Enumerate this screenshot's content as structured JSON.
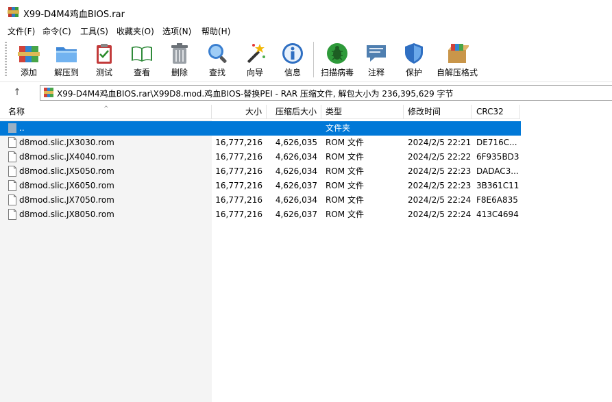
{
  "window": {
    "title": "X99-D4M4鸡血BIOS.rar",
    "app_icon": "winrar-icon"
  },
  "menu": [
    {
      "label": "文件(F)"
    },
    {
      "label": "命令(C)"
    },
    {
      "label": "工具(S)"
    },
    {
      "label": "收藏夹(O)"
    },
    {
      "label": "选项(N)"
    },
    {
      "label": "帮助(H)"
    }
  ],
  "toolbar": [
    {
      "label": "添加",
      "icon": "add-archive-icon"
    },
    {
      "label": "解压到",
      "icon": "extract-folder-icon"
    },
    {
      "label": "测试",
      "icon": "test-clipboard-icon"
    },
    {
      "label": "查看",
      "icon": "view-book-icon"
    },
    {
      "label": "删除",
      "icon": "trash-icon"
    },
    {
      "label": "查找",
      "icon": "find-magnifier-icon"
    },
    {
      "label": "向导",
      "icon": "wizard-wand-icon"
    },
    {
      "label": "信息",
      "icon": "info-icon"
    },
    {
      "label": "扫描病毒",
      "icon": "virus-scan-icon"
    },
    {
      "label": "注释",
      "icon": "comment-icon"
    },
    {
      "label": "保护",
      "icon": "shield-icon"
    },
    {
      "label": "自解压格式",
      "icon": "sfx-box-icon"
    }
  ],
  "address": {
    "up_icon": "up-arrow-icon",
    "path": "X99-D4M4鸡血BIOS.rar\\X99D8.mod.鸡血BIOS-替换PEI - RAR 压缩文件, 解包大小为 236,395,629 字节"
  },
  "columns": {
    "name": "名称",
    "size": "大小",
    "packed": "压缩后大小",
    "type": "类型",
    "modified": "修改时间",
    "crc": "CRC32"
  },
  "parent_row": {
    "name": "..",
    "type": "文件夹"
  },
  "files": [
    {
      "name": "d8mod.slic.JX3030.rom",
      "size": "16,777,216",
      "packed": "4,626,035",
      "type": "ROM 文件",
      "modified": "2024/2/5 22:21",
      "crc": "DE716C..."
    },
    {
      "name": "d8mod.slic.JX4040.rom",
      "size": "16,777,216",
      "packed": "4,626,034",
      "type": "ROM 文件",
      "modified": "2024/2/5 22:22",
      "crc": "6F935BD3"
    },
    {
      "name": "d8mod.slic.JX5050.rom",
      "size": "16,777,216",
      "packed": "4,626,034",
      "type": "ROM 文件",
      "modified": "2024/2/5 22:23",
      "crc": "DADAC3..."
    },
    {
      "name": "d8mod.slic.JX6050.rom",
      "size": "16,777,216",
      "packed": "4,626,037",
      "type": "ROM 文件",
      "modified": "2024/2/5 22:23",
      "crc": "3B361C11"
    },
    {
      "name": "d8mod.slic.JX7050.rom",
      "size": "16,777,216",
      "packed": "4,626,034",
      "type": "ROM 文件",
      "modified": "2024/2/5 22:24",
      "crc": "F8E6A835"
    },
    {
      "name": "d8mod.slic.JX8050.rom",
      "size": "16,777,216",
      "packed": "4,626,037",
      "type": "ROM 文件",
      "modified": "2024/2/5 22:24",
      "crc": "413C4694"
    }
  ]
}
